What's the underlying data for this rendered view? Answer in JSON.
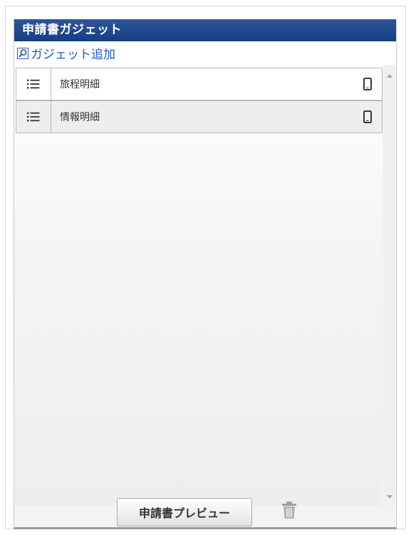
{
  "panel": {
    "title": "申請書ガジェット",
    "add_gadget_label": "ガジェット追加"
  },
  "gadgets": [
    {
      "label": "旅程明細",
      "handle_icon": "list-icon",
      "device_icon": "mobile-icon"
    },
    {
      "label": "情報明細",
      "handle_icon": "list-icon",
      "device_icon": "mobile-icon"
    }
  ],
  "footer": {
    "preview_label": "申請書プレビュー",
    "delete_icon": "trash-icon"
  },
  "colors": {
    "header_bg": "#1f4689",
    "link": "#1f5db5"
  }
}
